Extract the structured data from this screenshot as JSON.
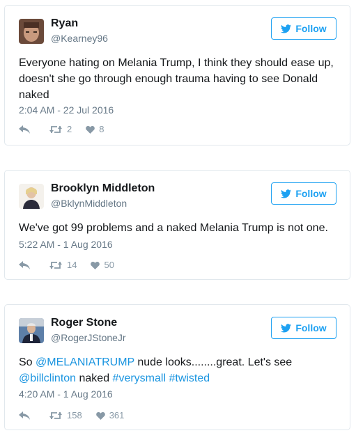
{
  "colors": {
    "link": "#1b95e0",
    "accent": "#1da1f2",
    "muted": "#657786",
    "icon": "#8899a6"
  },
  "tweets": [
    {
      "name": "Ryan",
      "handle": "@Kearney96",
      "follow_label": "Follow",
      "text_parts": [
        "Everyone hating on Melania Trump, I think they should ease up, doesn't she go through enough trauma having to see Donald naked"
      ],
      "timestamp": "2:04 AM - 22 Jul 2016",
      "retweets": "2",
      "likes": "8"
    },
    {
      "name": "Brooklyn Middleton",
      "handle": "@BklynMiddleton",
      "follow_label": "Follow",
      "text_parts": [
        "We've got 99 problems and a naked Melania Trump is not one."
      ],
      "timestamp": "5:22 AM - 1 Aug 2016",
      "retweets": "14",
      "likes": "50"
    },
    {
      "name": "Roger Stone",
      "handle": "@RogerJStoneJr",
      "follow_label": "Follow",
      "text_parts": [
        "So ",
        "@MELANIATRUMP",
        " nude looks........great. Let's see ",
        "@billclinton",
        " naked ",
        "#verysmall",
        " ",
        "#twisted"
      ],
      "timestamp": "4:20 AM - 1 Aug 2016",
      "retweets": "158",
      "likes": "361"
    }
  ]
}
